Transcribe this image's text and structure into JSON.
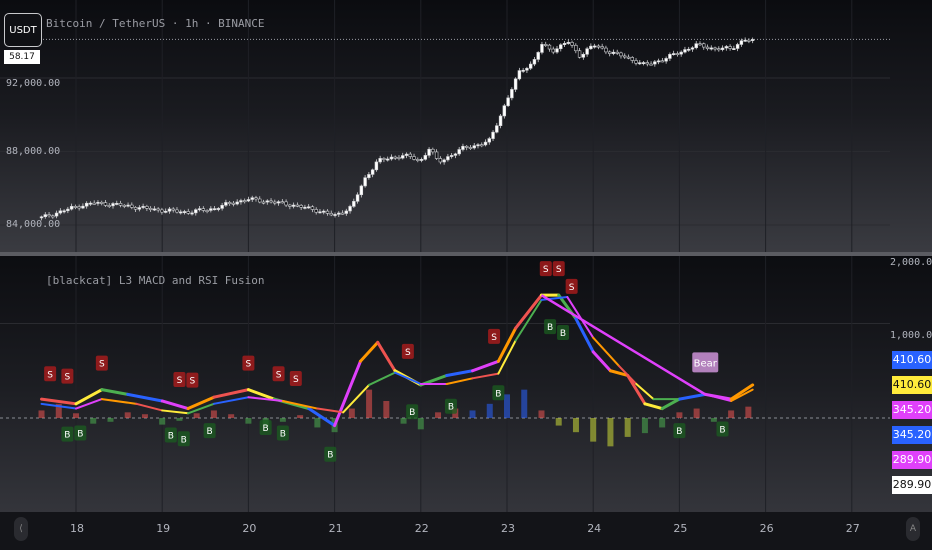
{
  "header": {
    "ticker_badge": "USDT",
    "price_tag": "58.17",
    "title": "Bitcoin / TetherUS · 1h · BINANCE"
  },
  "indicator": {
    "title": "[blackcat] L3 MACD and RSI Fusion"
  },
  "axis": {
    "price_ticks": [
      "92,000.00",
      "88,000.00",
      "84,000.00"
    ],
    "ind_ticks": [
      "2,000.00",
      "1,000.00"
    ],
    "x_ticks": [
      "18",
      "19",
      "20",
      "21",
      "22",
      "23",
      "24",
      "25",
      "26",
      "27"
    ],
    "nav_left": "⟨",
    "nav_right": "A"
  },
  "right_labels": [
    {
      "text": "410.60",
      "bg": "#2962ff",
      "fg": "#ffffff"
    },
    {
      "text": "410.60",
      "bg": "#ffeb3b",
      "fg": "#111111"
    },
    {
      "text": "345.20",
      "bg": "#e040fb",
      "fg": "#ffffff"
    },
    {
      "text": "345.20",
      "bg": "#2962ff",
      "fg": "#ffffff"
    },
    {
      "text": "289.90",
      "bg": "#e040fb",
      "fg": "#ffffff"
    },
    {
      "text": "289.90",
      "bg": "#ffffff",
      "fg": "#111111"
    }
  ],
  "signal_labels": {
    "sell": "S",
    "buy": "B",
    "bear": "Bear"
  },
  "colors": {
    "up": "#26a69a",
    "down": "#ef5350",
    "blue": "#2962ff",
    "magenta": "#e040fb",
    "yellow": "#ffeb3b",
    "green": "#4caf50"
  },
  "chart_data": [
    {
      "type": "candlestick",
      "title": "Bitcoin / TetherUS · 1h · BINANCE",
      "x_ticks": [
        "18",
        "19",
        "20",
        "21",
        "22",
        "23",
        "24",
        "25",
        "26",
        "27"
      ],
      "ylim": [
        83500,
        95500
      ],
      "y_ticks": [
        92000,
        88000,
        84000
      ],
      "last_price_line": 94100,
      "close_path": [
        [
          17.6,
          84400
        ],
        [
          17.8,
          84700
        ],
        [
          18.0,
          85000
        ],
        [
          18.2,
          85200
        ],
        [
          18.5,
          85100
        ],
        [
          18.8,
          84900
        ],
        [
          19.0,
          84800
        ],
        [
          19.3,
          84700
        ],
        [
          19.6,
          84900
        ],
        [
          19.8,
          85200
        ],
        [
          20.0,
          85400
        ],
        [
          20.2,
          85300
        ],
        [
          20.5,
          85100
        ],
        [
          20.8,
          84800
        ],
        [
          21.0,
          84500
        ],
        [
          21.2,
          85000
        ],
        [
          21.35,
          86500
        ],
        [
          21.5,
          87500
        ],
        [
          21.8,
          87800
        ],
        [
          22.0,
          87500
        ],
        [
          22.1,
          88200
        ],
        [
          22.2,
          87400
        ],
        [
          22.35,
          87800
        ],
        [
          22.5,
          88200
        ],
        [
          22.7,
          88400
        ],
        [
          22.8,
          88600
        ],
        [
          22.9,
          89700
        ],
        [
          23.0,
          90800
        ],
        [
          23.15,
          92400
        ],
        [
          23.3,
          92800
        ],
        [
          23.4,
          93800
        ],
        [
          23.55,
          93500
        ],
        [
          23.7,
          94000
        ],
        [
          23.85,
          93200
        ],
        [
          24.0,
          93800
        ],
        [
          24.2,
          93400
        ],
        [
          24.4,
          93100
        ],
        [
          24.6,
          92700
        ],
        [
          24.8,
          93000
        ],
        [
          25.0,
          93400
        ],
        [
          25.2,
          93800
        ],
        [
          25.4,
          93600
        ],
        [
          25.6,
          93600
        ],
        [
          25.75,
          94100
        ],
        [
          25.85,
          94000
        ]
      ]
    },
    {
      "type": "line",
      "title": "[blackcat] L3 MACD and RSI Fusion",
      "ylim": [
        -450,
        2000
      ],
      "y_ticks": [
        2000,
        1000
      ],
      "series": [
        {
          "points": [
            [
              17.6,
              200
            ],
            [
              18.0,
              150
            ],
            [
              18.3,
              300
            ],
            [
              18.6,
              250
            ],
            [
              19.0,
              180
            ],
            [
              19.3,
              100
            ],
            [
              19.6,
              220
            ],
            [
              20.0,
              300
            ],
            [
              20.3,
              200
            ],
            [
              20.7,
              100
            ],
            [
              21.0,
              -80
            ],
            [
              21.3,
              600
            ],
            [
              21.5,
              800
            ],
            [
              21.7,
              500
            ],
            [
              22.0,
              350
            ],
            [
              22.3,
              450
            ],
            [
              22.6,
              500
            ],
            [
              22.9,
              600
            ],
            [
              23.1,
              950
            ],
            [
              23.4,
              1300
            ],
            [
              23.6,
              1300
            ],
            [
              23.8,
              1050
            ],
            [
              24.0,
              700
            ],
            [
              24.2,
              500
            ],
            [
              24.4,
              450
            ],
            [
              24.6,
              150
            ],
            [
              24.8,
              100
            ],
            [
              25.0,
              200
            ],
            [
              25.3,
              250
            ],
            [
              25.6,
              200
            ],
            [
              25.85,
              350
            ]
          ]
        },
        {
          "points": [
            [
              17.6,
              150
            ],
            [
              18.0,
              100
            ],
            [
              18.3,
              200
            ],
            [
              18.7,
              150
            ],
            [
              19.0,
              80
            ],
            [
              19.3,
              50
            ],
            [
              19.6,
              150
            ],
            [
              20.0,
              220
            ],
            [
              20.4,
              180
            ],
            [
              20.8,
              100
            ],
            [
              21.1,
              60
            ],
            [
              21.4,
              350
            ],
            [
              21.7,
              480
            ],
            [
              22.0,
              360
            ],
            [
              22.3,
              360
            ],
            [
              22.6,
              420
            ],
            [
              22.9,
              470
            ],
            [
              23.1,
              820
            ],
            [
              23.4,
              1250
            ],
            [
              23.7,
              1280
            ],
            [
              24.0,
              850
            ],
            [
              24.3,
              550
            ],
            [
              24.5,
              360
            ],
            [
              24.7,
              200
            ],
            [
              25.0,
              200
            ],
            [
              25.3,
              250
            ],
            [
              25.6,
              180
            ],
            [
              25.85,
              300
            ]
          ]
        }
      ],
      "histogram": [
        [
          17.6,
          80
        ],
        [
          17.8,
          150
        ],
        [
          18.0,
          50
        ],
        [
          18.2,
          -60
        ],
        [
          18.4,
          -40
        ],
        [
          18.6,
          60
        ],
        [
          18.8,
          40
        ],
        [
          19.0,
          -70
        ],
        [
          19.2,
          -30
        ],
        [
          19.4,
          50
        ],
        [
          19.6,
          80
        ],
        [
          19.8,
          40
        ],
        [
          20.0,
          -60
        ],
        [
          20.2,
          -90
        ],
        [
          20.4,
          -40
        ],
        [
          20.6,
          30
        ],
        [
          20.8,
          -100
        ],
        [
          21.0,
          -150
        ],
        [
          21.2,
          100
        ],
        [
          21.4,
          300
        ],
        [
          21.6,
          180
        ],
        [
          21.8,
          -60
        ],
        [
          22.0,
          -120
        ],
        [
          22.2,
          60
        ],
        [
          22.4,
          100
        ],
        [
          22.6,
          80
        ],
        [
          22.8,
          150
        ],
        [
          23.0,
          250
        ],
        [
          23.2,
          300
        ],
        [
          23.4,
          80
        ],
        [
          23.6,
          -80
        ],
        [
          23.8,
          -150
        ],
        [
          24.0,
          -250
        ],
        [
          24.2,
          -300
        ],
        [
          24.4,
          -200
        ],
        [
          24.6,
          -160
        ],
        [
          24.8,
          -100
        ],
        [
          25.0,
          60
        ],
        [
          25.2,
          100
        ],
        [
          25.4,
          -40
        ],
        [
          25.6,
          80
        ],
        [
          25.8,
          120
        ]
      ],
      "sell_signals": [
        17.7,
        17.9,
        18.3,
        19.2,
        19.35,
        20.0,
        20.35,
        20.55,
        21.85,
        22.85,
        23.45,
        23.6,
        23.75
      ],
      "buy_signals": [
        17.9,
        18.05,
        19.1,
        19.25,
        19.55,
        20.2,
        20.4,
        20.95,
        21.9,
        22.35,
        22.9,
        23.5,
        23.65,
        25.0,
        25.5
      ],
      "bear_divergence": {
        "from": [
          23.4,
          1300
        ],
        "to": [
          25.3,
          250
        ]
      }
    }
  ]
}
